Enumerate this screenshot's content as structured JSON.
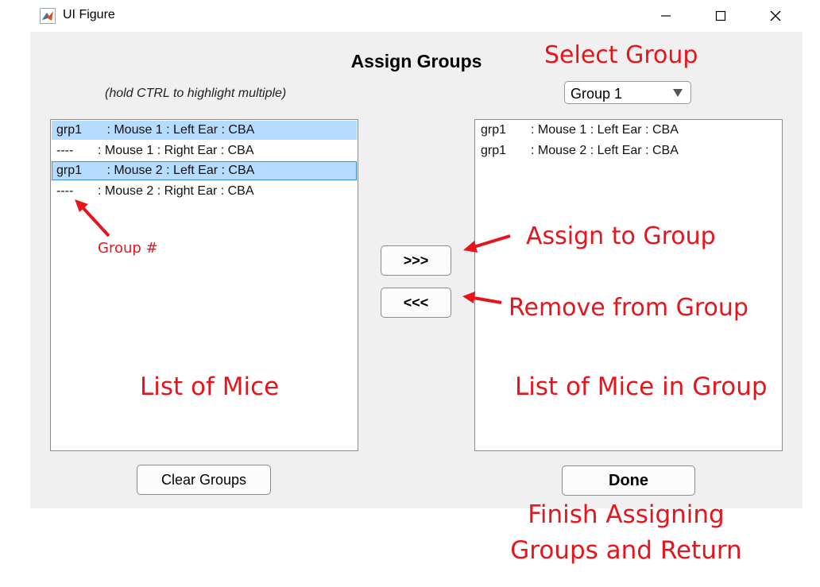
{
  "window": {
    "title": "UI Figure",
    "controls": {
      "minimize": "minimize-icon",
      "maximize": "maximize-icon",
      "close": "close-icon"
    }
  },
  "heading": "Assign Groups",
  "hint": "(hold CTRL to highlight multiple)",
  "group_select": {
    "value": "Group 1",
    "options": [
      "Group 1"
    ]
  },
  "mice_list": [
    {
      "group": "grp1",
      "desc": " : Mouse 1 : Left Ear : CBA",
      "selected": true
    },
    {
      "group": "----",
      "desc": ": Mouse 1 : Right Ear : CBA",
      "selected": false
    },
    {
      "group": "grp1",
      "desc": " : Mouse 2 : Left Ear : CBA",
      "selected": true
    },
    {
      "group": "----",
      "desc": ": Mouse 2 : Right Ear : CBA",
      "selected": false
    }
  ],
  "group_list": [
    {
      "group": "grp1",
      "desc": ": Mouse 1 : Left Ear : CBA"
    },
    {
      "group": "grp1",
      "desc": ": Mouse 2 : Left Ear : CBA"
    }
  ],
  "buttons": {
    "assign": ">>>",
    "remove": "<<<",
    "clear": "Clear Groups",
    "done": "Done"
  },
  "annotations": {
    "select_group": "Select Group",
    "group_number": "Group #",
    "assign_to_group": "Assign to Group",
    "remove_from_group": "Remove from Group",
    "list_of_mice": "List of Mice",
    "list_of_mice_in_group": "List of Mice in Group",
    "finish_line1": "Finish Assigning",
    "finish_line2": "Groups and Return"
  },
  "colors": {
    "annotation": "#e8141c",
    "selection": "#b5dbff",
    "window_bg": "#f0f0f0"
  }
}
